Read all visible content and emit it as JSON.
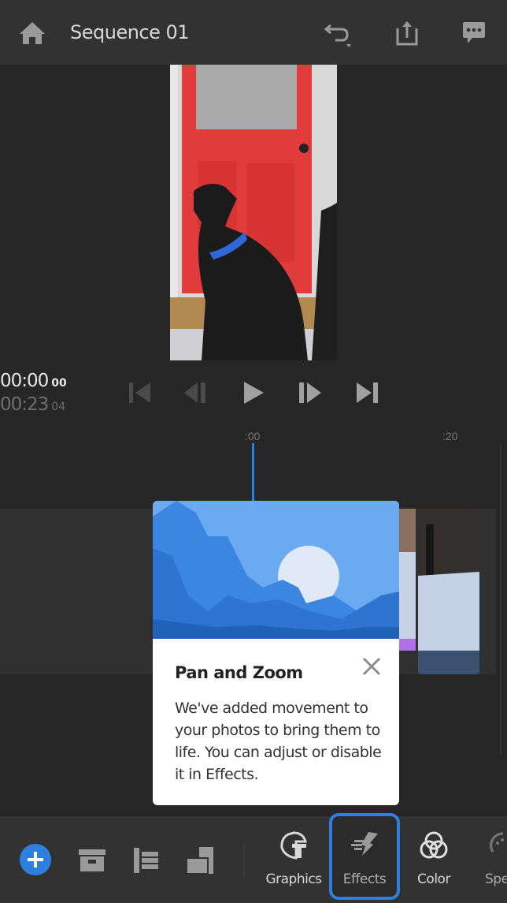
{
  "header": {
    "title": "Sequence 01",
    "icons": [
      "home-icon",
      "undo-icon",
      "share-icon",
      "feedback-icon"
    ]
  },
  "timecode": {
    "current": "00:00",
    "current_frames": "00",
    "duration": "00:23",
    "duration_frames": "04"
  },
  "transport": [
    "go-to-start",
    "step-back",
    "play",
    "step-forward",
    "go-to-end"
  ],
  "ruler": {
    "marks": [
      ":00",
      ":20"
    ]
  },
  "popup": {
    "title": "Pan and Zoom",
    "body": "We've added movement to your photos to bring them to life. You can adjust or disable it in Effects."
  },
  "toolbar": {
    "tools": [
      {
        "label": "Graphics",
        "icon": "graphics-icon"
      },
      {
        "label": "Effects",
        "icon": "effects-icon",
        "active": true
      },
      {
        "label": "Color",
        "icon": "color-icon"
      },
      {
        "label": "Spe",
        "icon": "speed-icon"
      }
    ]
  },
  "colors": {
    "accent": "#2d80e0",
    "clip_marker": "#b070e8"
  }
}
